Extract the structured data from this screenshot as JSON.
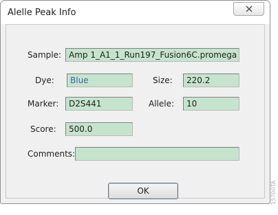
{
  "window": {
    "title": "Alelle Peak Info",
    "close_icon": "close-icon"
  },
  "form": {
    "sample_label": "Sample:",
    "sample_value": "Amp 1_A1_1_Run197_Fusion6C.promega",
    "dye_label": "Dye:",
    "dye_value": "Blue",
    "size_label": "Size:",
    "size_value": "220.2",
    "marker_label": "Marker:",
    "marker_value": "D2S441",
    "allele_label": "Allele:",
    "allele_value": "10",
    "score_label": "Score:",
    "score_value": "500.0",
    "comments_label": "Comments:",
    "comments_value": ""
  },
  "buttons": {
    "ok_label": "OK"
  },
  "colors": {
    "field_background": "#c6e4cd",
    "dye_text": "#3a64a8"
  },
  "watermark": {
    "text": "15700TA"
  }
}
